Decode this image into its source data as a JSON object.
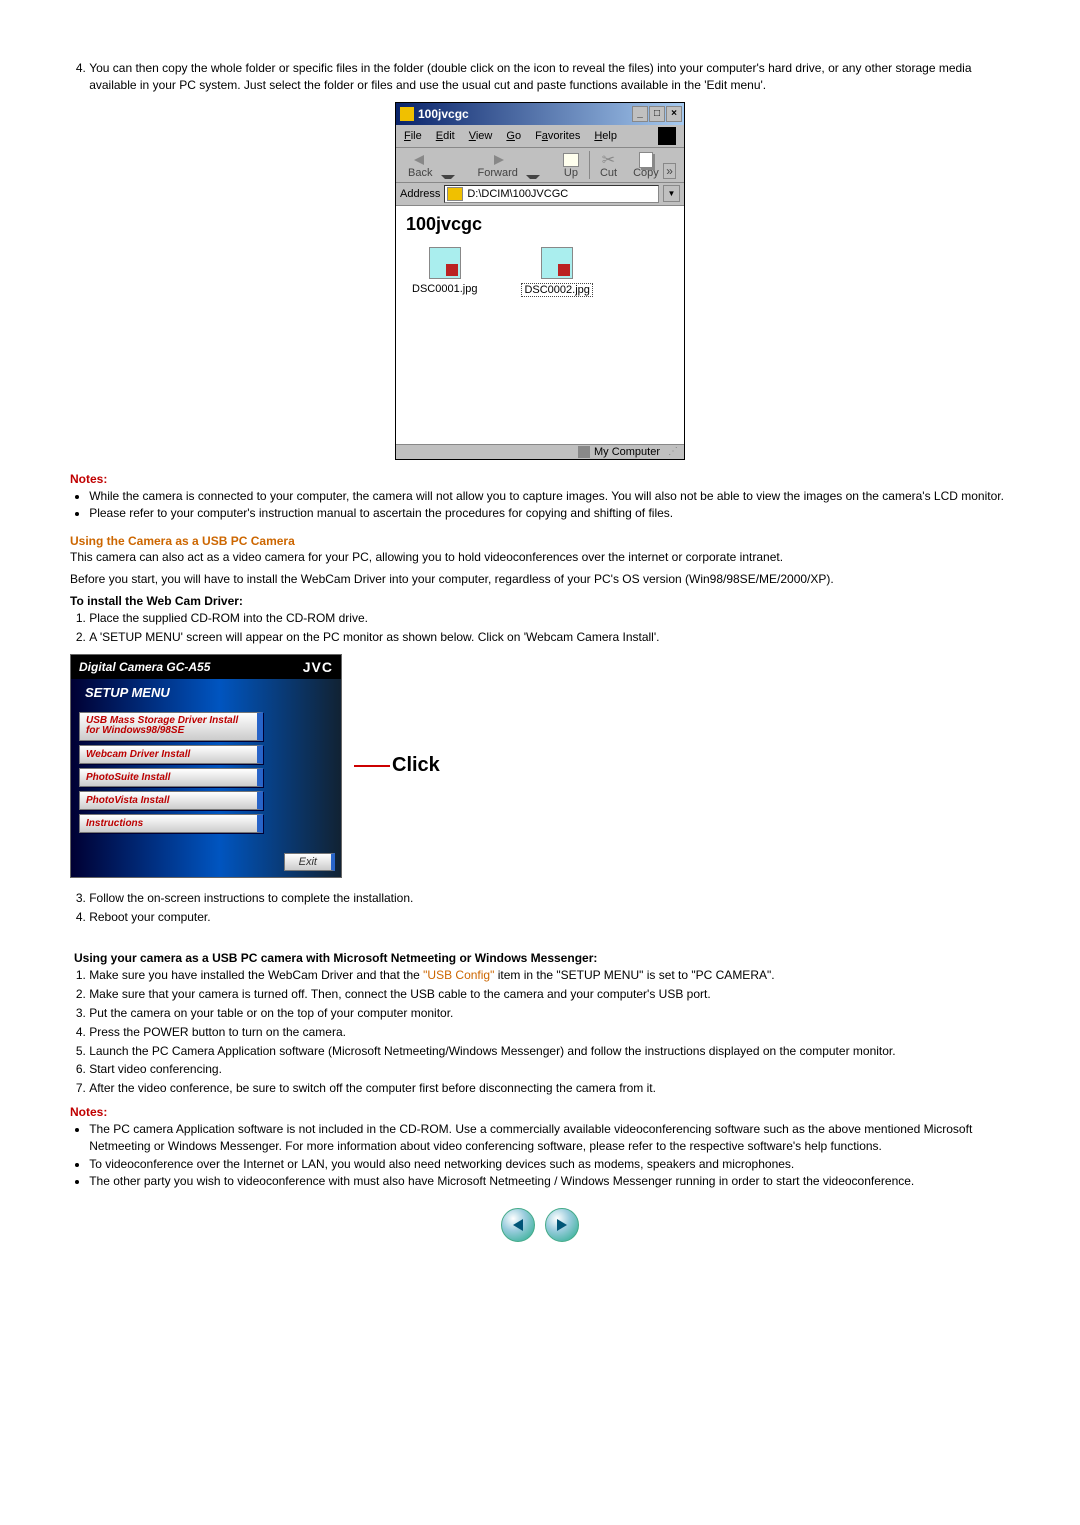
{
  "intro_step4": {
    "num": "4.",
    "text_a": "You can then copy the whole folder or specific files in the folder (double click on the icon to reveal the files) into your computer's hard drive, or any other storage media available in your PC system. Just select the folder or files and use the usual cut and paste functions available in the 'Edit menu'."
  },
  "explorer": {
    "title": "100jvcgc",
    "menu": {
      "file": "File",
      "edit": "Edit",
      "view": "View",
      "go": "Go",
      "favorites": "Favorites",
      "help": "Help"
    },
    "toolbar": {
      "back": "Back",
      "forward": "Forward",
      "up": "Up",
      "cut": "Cut",
      "copy": "Copy"
    },
    "address_label": "Address",
    "address_path": "D:\\DCIM\\100JVCGC",
    "folder_title": "100jvcgc",
    "files": [
      {
        "name": "DSC0001.jpg",
        "selected": false
      },
      {
        "name": "DSC0002.jpg",
        "selected": true
      }
    ],
    "status": "My Computer"
  },
  "notes1": {
    "heading": "Notes:",
    "items": [
      "While the camera is connected to your computer, the camera will not allow you to capture images. You will also not be able to view the images on the camera's LCD monitor.",
      "Please refer to your computer's instruction manual to ascertain the procedures for copying and shifting of files."
    ]
  },
  "section_usb": {
    "heading": "Using the Camera as a USB PC Camera",
    "para1": "This camera can also act as a video camera for your PC, allowing you to hold videoconferences over the internet or corporate intranet.",
    "para2": "Before you start, you will have to install the WebCam Driver into your computer, regardless of your PC's OS version (Win98/98SE/ME/2000/XP)."
  },
  "install_webcam": {
    "heading": "To install the Web Cam Driver:",
    "steps": [
      "Place the supplied CD-ROM into the CD-ROM drive.",
      "A 'SETUP MENU' screen will appear on the PC monitor as shown below. Click on 'Webcam Camera Install'."
    ],
    "after": [
      "Follow the on-screen instructions to complete the installation.",
      "Reboot your computer."
    ]
  },
  "setup_menu": {
    "header_left": "Digital Camera GC-A55",
    "header_right": "JVC",
    "title": "SETUP MENU",
    "items": [
      "USB Mass Storage Driver Install for Windows98/98SE",
      "Webcam Driver Install",
      "PhotoSuite Install",
      "PhotoVista Install",
      "Instructions"
    ],
    "exit": "Exit",
    "click_label": "Click"
  },
  "netmeeting": {
    "heading": "Using your camera as a USB PC camera with Microsoft Netmeeting or Windows Messenger:",
    "steps": [
      {
        "pre": "Make sure you have installed the WebCam Driver and that the ",
        "link": "\"USB Config\"",
        "post": " item in the \"SETUP MENU\" is set to \"PC CAMERA\"."
      },
      {
        "pre": "Make sure that your camera is turned off. Then, connect the USB cable to the camera and your computer's USB port.",
        "link": "",
        "post": ""
      },
      {
        "pre": "Put the camera on your table or on the top of your computer monitor.",
        "link": "",
        "post": ""
      },
      {
        "pre": "Press the POWER button to turn on the camera.",
        "link": "",
        "post": ""
      },
      {
        "pre": "Launch the PC Camera Application software (Microsoft Netmeeting/Windows Messenger) and follow the instructions displayed on the computer monitor.",
        "link": "",
        "post": ""
      },
      {
        "pre": "Start video conferencing.",
        "link": "",
        "post": ""
      },
      {
        "pre": "After the video conference, be sure to switch off the computer first before disconnecting the camera from it.",
        "link": "",
        "post": ""
      }
    ]
  },
  "notes2": {
    "heading": "Notes:",
    "items": [
      "The PC camera Application software is not included in the CD-ROM. Use a commercially available videoconferencing software such as the above mentioned Microsoft Netmeeting or Windows Messenger. For more information about video conferencing software, please refer to the respective software's help functions.",
      "To videoconference over the Internet or LAN, you would also need networking devices such as modems, speakers and microphones.",
      "The other party you wish to videoconference with must also have Microsoft Netmeeting / Windows Messenger running in order to start the videoconference."
    ]
  }
}
